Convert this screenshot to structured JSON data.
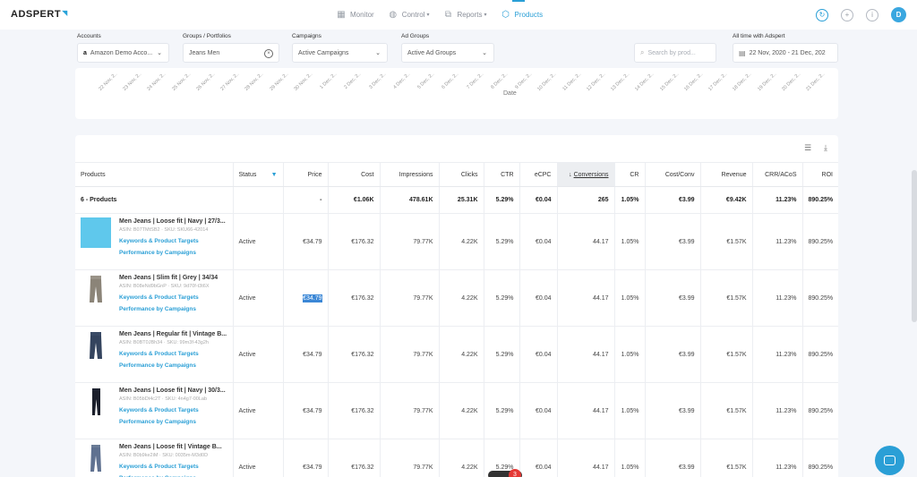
{
  "app": {
    "logo": "ADSPERT"
  },
  "nav": [
    {
      "label": "Monitor",
      "icon": "monitor-icon",
      "active": false,
      "caret": false
    },
    {
      "label": "Control",
      "icon": "control-icon",
      "active": false,
      "caret": true
    },
    {
      "label": "Reports",
      "icon": "reports-icon",
      "active": false,
      "caret": true
    },
    {
      "label": "Products",
      "icon": "products-icon",
      "active": true,
      "caret": false
    }
  ],
  "avatar": "D",
  "filters": {
    "accounts": {
      "label": "Accounts",
      "value": "Amazon Demo Acco..."
    },
    "groups": {
      "label": "Groups / Portfolios",
      "value": "Jeans Men"
    },
    "campaigns": {
      "label": "Campaigns",
      "value": "Active Campaigns"
    },
    "adgroups": {
      "label": "Ad Groups",
      "value": "Active Ad Groups"
    },
    "search": {
      "placeholder": "Search by prod..."
    },
    "daterange": {
      "label": "All time with Adspert",
      "value": "22 Nov, 2020 - 21 Dec, 202"
    }
  },
  "chart": {
    "xlabel": "Date",
    "ticks": [
      "22 Nov, 2..",
      "23 Nov, 2..",
      "24 Nov, 2..",
      "25 Nov, 2..",
      "26 Nov, 2..",
      "27 Nov, 2..",
      "28 Nov, 2..",
      "29 Nov, 2..",
      "30 Nov, 2..",
      "1 Dec, 2..",
      "2 Dec, 2..",
      "3 Dec, 2..",
      "4 Dec, 2..",
      "5 Dec, 2..",
      "6 Dec, 2..",
      "7 Dec, 2..",
      "8 Dec, 2..",
      "9 Dec, 2..",
      "10 Dec, 2..",
      "11 Dec, 2..",
      "12 Dec, 2..",
      "13 Dec, 2..",
      "14 Dec, 2..",
      "15 Dec, 2..",
      "16 Dec, 2..",
      "17 Dec, 2..",
      "18 Dec, 2..",
      "19 Dec, 2..",
      "20 Dec, 2..",
      "21 Dec, 2.."
    ]
  },
  "table": {
    "columns": [
      "Products",
      "Status",
      "Price",
      "Cost",
      "Impressions",
      "Clicks",
      "CTR",
      "eCPC",
      "Conversions",
      "CR",
      "Cost/Conv",
      "Revenue",
      "CRR/ACoS",
      "ROI"
    ],
    "summary": [
      "6 - Products",
      "",
      "-",
      "€1.06K",
      "478.61K",
      "25.31K",
      "5.29%",
      "€0.04",
      "265",
      "1.05%",
      "€3.99",
      "€9.42K",
      "11.23%",
      "890.25%"
    ],
    "link_keywords": "Keywords & Product Targets",
    "link_performance": "Performance by Campaigns",
    "rows": [
      {
        "title": "Men Jeans | Loose fit | Navy | 27/3...",
        "sub": "ASIN: B07TMtSB2 · SKU: SKU66-42014",
        "status": "Active",
        "price": "€34.79",
        "cost": "€176.32",
        "impressions": "79.77K",
        "clicks": "4.22K",
        "ctr": "5.29%",
        "ecpc": "€0.04",
        "conversions": "44.17",
        "cr": "1.05%",
        "costconv": "€3.99",
        "revenue": "€1.57K",
        "crr": "11.23%",
        "roi": "890.25%"
      },
      {
        "title": "Men Jeans | Slim fit | Grey | 34/34",
        "sub": "ASIN: B08eNd9bGnP · SKU: 9d70f-t3t6X",
        "status": "Active",
        "price": "€34.79",
        "cost": "€176.32",
        "impressions": "79.77K",
        "clicks": "4.22K",
        "ctr": "5.29%",
        "ecpc": "€0.04",
        "conversions": "44.17",
        "cr": "1.05%",
        "costconv": "€3.99",
        "revenue": "€1.57K",
        "crr": "11.23%",
        "roi": "890.25%"
      },
      {
        "title": "Men Jeans | Regular fit | Vintage B...",
        "sub": "ASIN: B0BT0JBh34 · SKU: 99m3f-43g2h",
        "status": "Active",
        "price": "€34.79",
        "cost": "€176.32",
        "impressions": "79.77K",
        "clicks": "4.22K",
        "ctr": "5.29%",
        "ecpc": "€0.04",
        "conversions": "44.17",
        "cr": "1.05%",
        "costconv": "€3.99",
        "revenue": "€1.57K",
        "crr": "11.23%",
        "roi": "890.25%"
      },
      {
        "title": "Men Jeans | Loose fit | Navy | 30/3...",
        "sub": "ASIN: B05bDt4c2T · SKU: 4n4g7-00Lab",
        "status": "Active",
        "price": "€34.79",
        "cost": "€176.32",
        "impressions": "79.77K",
        "clicks": "4.22K",
        "ctr": "5.29%",
        "ecpc": "€0.04",
        "conversions": "44.17",
        "cr": "1.05%",
        "costconv": "€3.99",
        "revenue": "€1.57K",
        "crr": "11.23%",
        "roi": "890.25%"
      },
      {
        "title": "Men Jeans | Loose fit | Vintage B...",
        "sub": "ASIN: B0b9ke2iM · SKU: 0035m-M3d0D",
        "status": "Active",
        "price": "€34.79",
        "cost": "€176.32",
        "impressions": "79.77K",
        "clicks": "4.22K",
        "ctr": "5.29%",
        "ecpc": "€0.04",
        "conversions": "44.17",
        "cr": "1.05%",
        "costconv": "€3.99",
        "revenue": "€1.57K",
        "crr": "11.23%",
        "roi": "890.25%"
      }
    ]
  },
  "notification_count": "3"
}
